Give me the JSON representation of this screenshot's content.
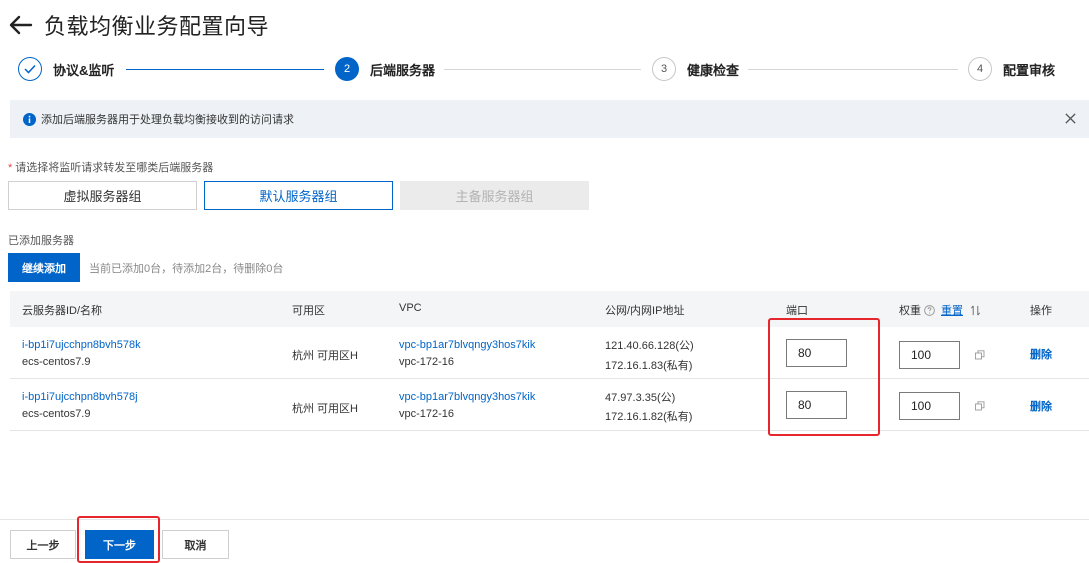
{
  "header": {
    "title": "负载均衡业务配置向导"
  },
  "steps": [
    {
      "index": "1",
      "label": "协议&监听",
      "state": "done"
    },
    {
      "index": "2",
      "label": "后端服务器",
      "state": "active"
    },
    {
      "index": "3",
      "label": "健康检查",
      "state": "todo"
    },
    {
      "index": "4",
      "label": "配置审核",
      "state": "todo"
    }
  ],
  "banner": {
    "text": "添加后端服务器用于处理负载均衡接收到的访问请求"
  },
  "selection": {
    "required_mark": "*",
    "label": "请选择将监听请求转发至哪类后端服务器",
    "options": [
      "虚拟服务器组",
      "默认服务器组",
      "主备服务器组"
    ],
    "selected": "默认服务器组"
  },
  "added": {
    "label": "已添加服务器",
    "continue_button": "继续添加",
    "status": "当前已添加0台，待添加2台，待删除0台"
  },
  "table": {
    "columns": {
      "id_name": "云服务器ID/名称",
      "zone": "可用区",
      "vpc": "VPC",
      "ip": "公网/内网IP地址",
      "port": "端口",
      "weight": "权重",
      "reset": "重置",
      "action": "操作"
    },
    "rows": [
      {
        "id": "i-bp1i7ujcchpn8bvh578k",
        "name": "ecs-centos7.9",
        "zone": "杭州 可用区H",
        "vpc_id": "vpc-bp1ar7blvqngy3hos7kik",
        "vpc_name": "vpc-172-16",
        "public_ip": "121.40.66.128(公)",
        "private_ip": "172.16.1.83(私有)",
        "port": "80",
        "weight": "100",
        "action": "删除"
      },
      {
        "id": "i-bp1i7ujcchpn8bvh578j",
        "name": "ecs-centos7.9",
        "zone": "杭州 可用区H",
        "vpc_id": "vpc-bp1ar7blvqngy3hos7kik",
        "vpc_name": "vpc-172-16",
        "public_ip": "47.97.3.35(公)",
        "private_ip": "172.16.1.82(私有)",
        "port": "80",
        "weight": "100",
        "action": "删除"
      }
    ]
  },
  "footer": {
    "prev": "上一步",
    "next": "下一步",
    "cancel": "取消"
  },
  "colors": {
    "primary": "#0064c8",
    "highlight": "#e5262d",
    "disabled": "#ebebeb"
  },
  "icons": [
    "back-arrow-icon",
    "check-icon",
    "info-icon",
    "close-icon",
    "help-icon",
    "sort-icon",
    "copy-icon"
  ]
}
